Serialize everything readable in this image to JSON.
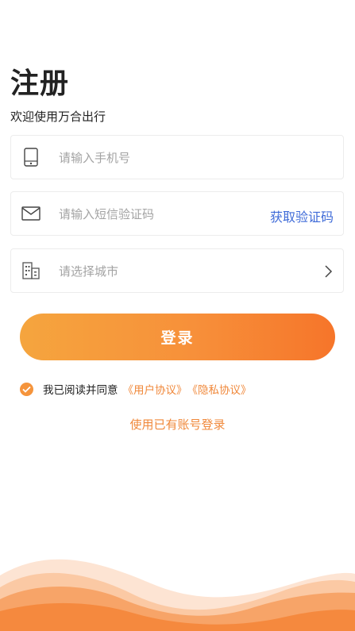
{
  "page": {
    "title": "注册",
    "subtitle": "欢迎使用万合出行"
  },
  "form": {
    "phone_placeholder": "请输入手机号",
    "code_placeholder": "请输入短信验证码",
    "get_code_label": "获取验证码",
    "city_placeholder": "请选择城市"
  },
  "login_button": "登录",
  "agreement": {
    "checked": true,
    "text": "我已阅读并同意",
    "user_agreement": "《用户协议》",
    "privacy_agreement": "《隐私协议》"
  },
  "existing_account_link": "使用已有账号登录",
  "icons": {
    "phone": "phone-icon",
    "envelope": "envelope-icon",
    "building": "building-icon",
    "chevron": "chevron-right-icon",
    "check": "check-icon"
  },
  "colors": {
    "accent": "#f5943c",
    "link_blue": "#3f6bd8",
    "button_gradient_start": "#f5a53e",
    "button_gradient_end": "#f6752a"
  }
}
